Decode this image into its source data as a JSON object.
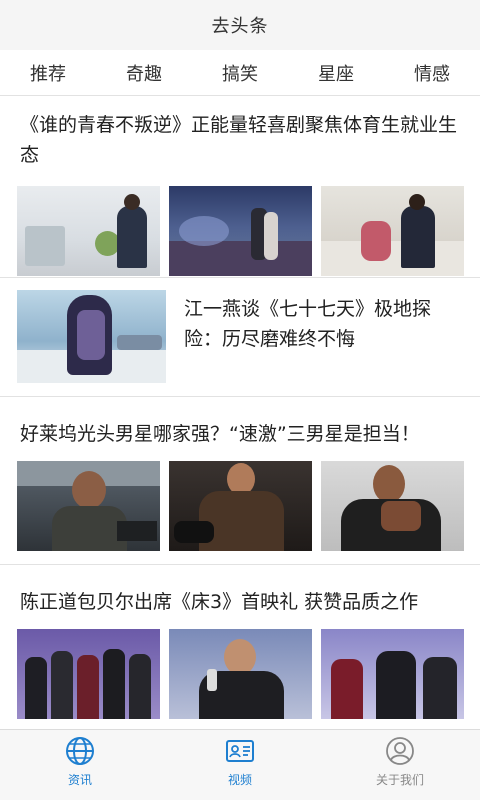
{
  "header": {
    "title": "去头条"
  },
  "tabs": [
    {
      "label": "推荐"
    },
    {
      "label": "奇趣"
    },
    {
      "label": "搞笑"
    },
    {
      "label": "星座"
    },
    {
      "label": "情感"
    }
  ],
  "articles": [
    {
      "title": "《谁的青春不叛逆》正能量轻喜剧聚焦体育生就业生态"
    },
    {
      "title": "江一燕谈《七十七天》极地探险：历尽磨难终不悔"
    },
    {
      "title": "好莱坞光头男星哪家强？“速激”三男星是担当！"
    },
    {
      "title": "陈正道包贝尔出席《床3》首映礼 获赞品质之作"
    }
  ],
  "bottom_nav": [
    {
      "label": "资讯",
      "icon": "globe-icon",
      "color": "#1e7fd0"
    },
    {
      "label": "视频",
      "icon": "video-card-icon",
      "color": "#1e7fd0"
    },
    {
      "label": "关于我们",
      "icon": "user-icon",
      "color": "#888888"
    }
  ]
}
